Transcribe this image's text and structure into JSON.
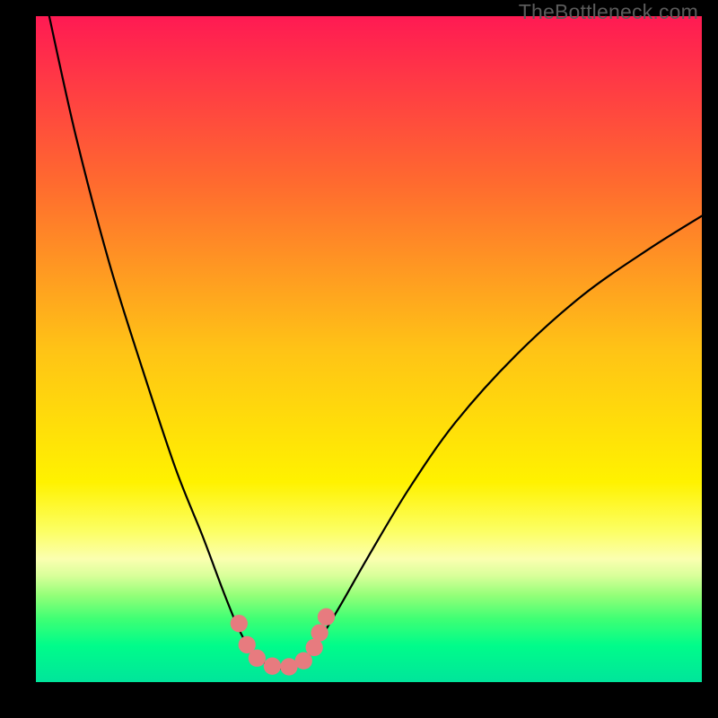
{
  "watermark": "TheBottleneck.com",
  "chart_data": {
    "type": "line",
    "title": "",
    "xlabel": "",
    "ylabel": "",
    "xlim": [
      0,
      100
    ],
    "ylim": [
      0,
      100
    ],
    "gradient_stops": [
      {
        "offset": 0,
        "color": "#ff1a53"
      },
      {
        "offset": 0.25,
        "color": "#ff6a2f"
      },
      {
        "offset": 0.5,
        "color": "#ffc316"
      },
      {
        "offset": 0.7,
        "color": "#fff200"
      },
      {
        "offset": 0.775,
        "color": "#fcff66"
      },
      {
        "offset": 0.815,
        "color": "#fbffb0"
      },
      {
        "offset": 0.84,
        "color": "#d9ff9a"
      },
      {
        "offset": 0.87,
        "color": "#93ff78"
      },
      {
        "offset": 0.905,
        "color": "#3fff74"
      },
      {
        "offset": 0.945,
        "color": "#00fc8a"
      },
      {
        "offset": 1.0,
        "color": "#00e59b"
      }
    ],
    "series": [
      {
        "name": "curve",
        "color": "#000000",
        "points": [
          {
            "x": 2,
            "y": 100
          },
          {
            "x": 6,
            "y": 82
          },
          {
            "x": 11,
            "y": 63
          },
          {
            "x": 16,
            "y": 47
          },
          {
            "x": 21,
            "y": 32
          },
          {
            "x": 25,
            "y": 22
          },
          {
            "x": 28,
            "y": 14
          },
          {
            "x": 30,
            "y": 9
          },
          {
            "x": 31.5,
            "y": 6
          },
          {
            "x": 33,
            "y": 4
          },
          {
            "x": 35,
            "y": 2.5
          },
          {
            "x": 37,
            "y": 2
          },
          {
            "x": 39,
            "y": 2.5
          },
          {
            "x": 41,
            "y": 4
          },
          {
            "x": 43,
            "y": 7
          },
          {
            "x": 46,
            "y": 12
          },
          {
            "x": 50,
            "y": 19
          },
          {
            "x": 56,
            "y": 29
          },
          {
            "x": 63,
            "y": 39
          },
          {
            "x": 72,
            "y": 49
          },
          {
            "x": 82,
            "y": 58
          },
          {
            "x": 92,
            "y": 65
          },
          {
            "x": 100,
            "y": 70
          }
        ]
      }
    ],
    "markers": {
      "color": "#e77b7f",
      "radius_data_units": 1.3,
      "points": [
        {
          "x": 30.5,
          "y": 8.8
        },
        {
          "x": 31.7,
          "y": 5.6
        },
        {
          "x": 33.2,
          "y": 3.6
        },
        {
          "x": 35.5,
          "y": 2.4
        },
        {
          "x": 38.0,
          "y": 2.3
        },
        {
          "x": 40.2,
          "y": 3.2
        },
        {
          "x": 41.8,
          "y": 5.2
        },
        {
          "x": 42.6,
          "y": 7.4
        },
        {
          "x": 43.6,
          "y": 9.8
        }
      ]
    }
  }
}
